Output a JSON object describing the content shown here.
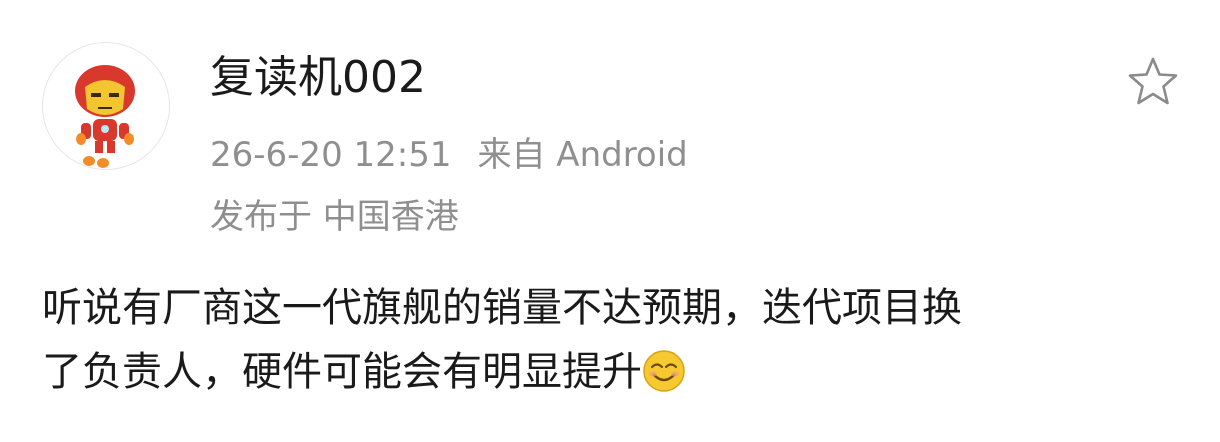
{
  "post": {
    "username": "复读机002",
    "timestamp": "26-6-20 12:51",
    "source": "来自 Android",
    "location": "发布于 中国香港",
    "content_line1": "听说有厂商这一代旗舰的销量不达预期，迭代项目换",
    "content_line2": "了负责人，硬件可能会有明显提升",
    "emoji": "smile-emoji",
    "avatar_icon": "iron-man-avatar-icon",
    "favorite_icon": "star-outline-icon"
  },
  "colors": {
    "text_primary": "#1a1a1a",
    "text_secondary": "#8f8f8f",
    "background": "#ffffff"
  }
}
